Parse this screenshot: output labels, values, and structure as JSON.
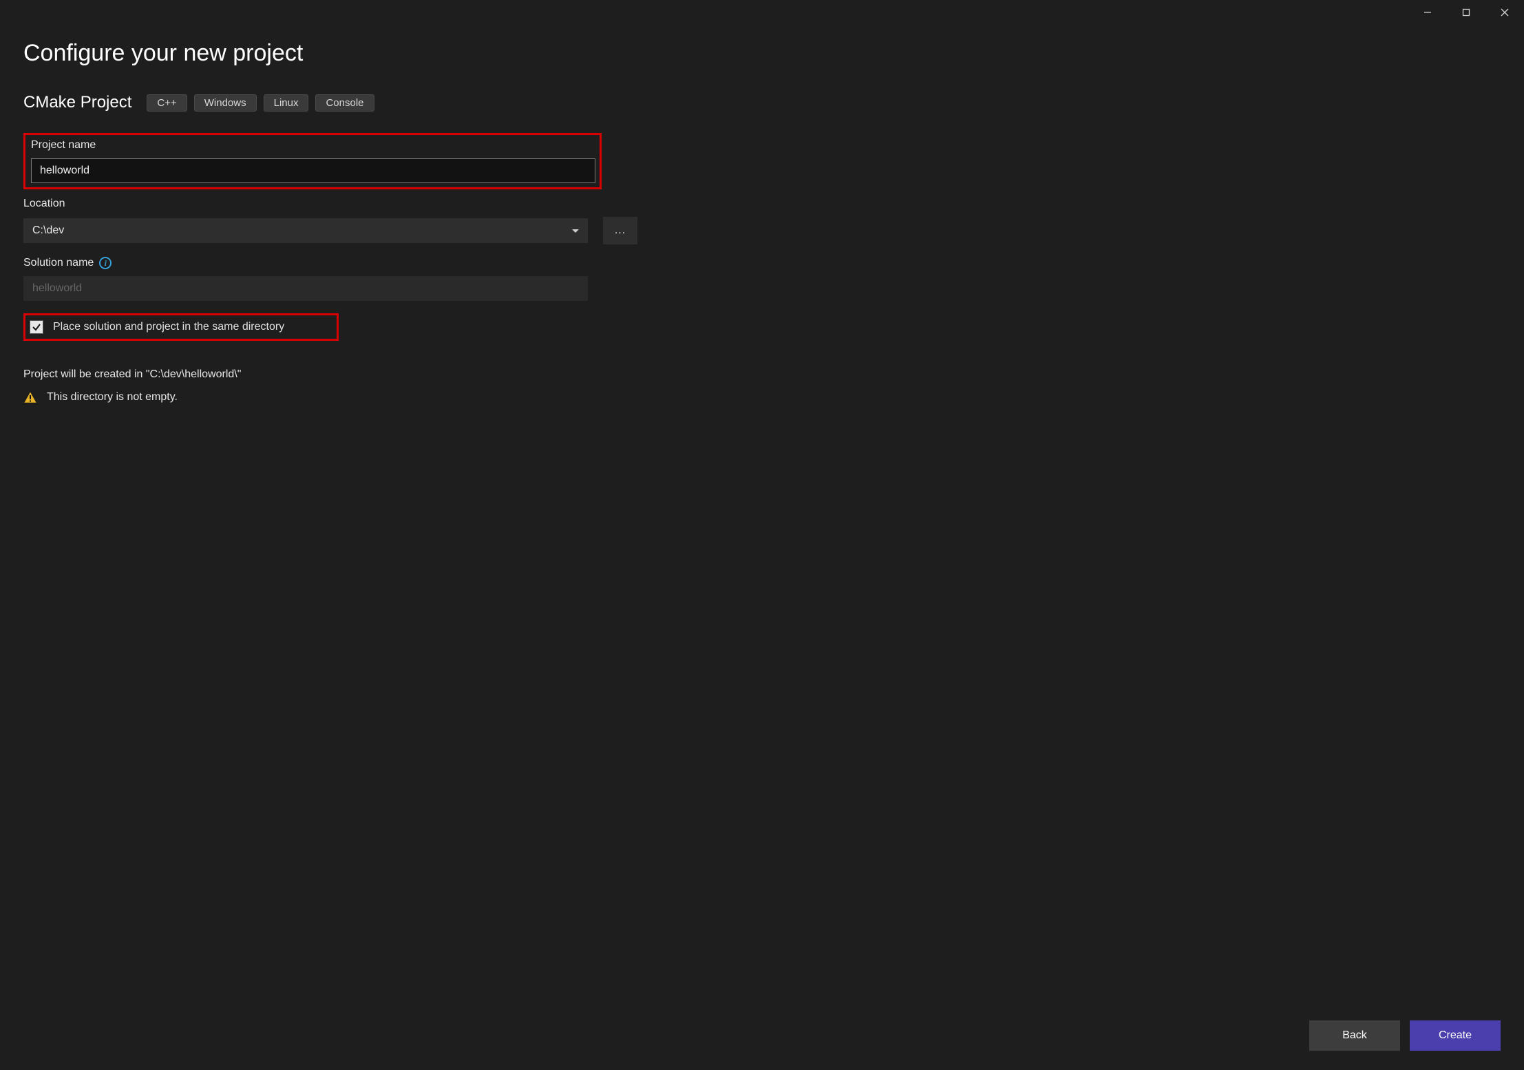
{
  "title": "Configure your new project",
  "template": {
    "name": "CMake Project",
    "tags": [
      "C++",
      "Windows",
      "Linux",
      "Console"
    ]
  },
  "fields": {
    "project_name": {
      "label": "Project name",
      "value": "helloworld"
    },
    "location": {
      "label": "Location",
      "value": "C:\\dev"
    },
    "solution_name": {
      "label": "Solution name",
      "placeholder": "helloworld"
    },
    "same_dir": {
      "label": "Place solution and project in the same directory",
      "checked": true
    }
  },
  "info_text": "Project will be created in \"C:\\dev\\helloworld\\\"",
  "warning_text": "This directory is not empty.",
  "buttons": {
    "back": "Back",
    "create": "Create"
  },
  "browse_label": "...",
  "info_icon_glyph": "i"
}
